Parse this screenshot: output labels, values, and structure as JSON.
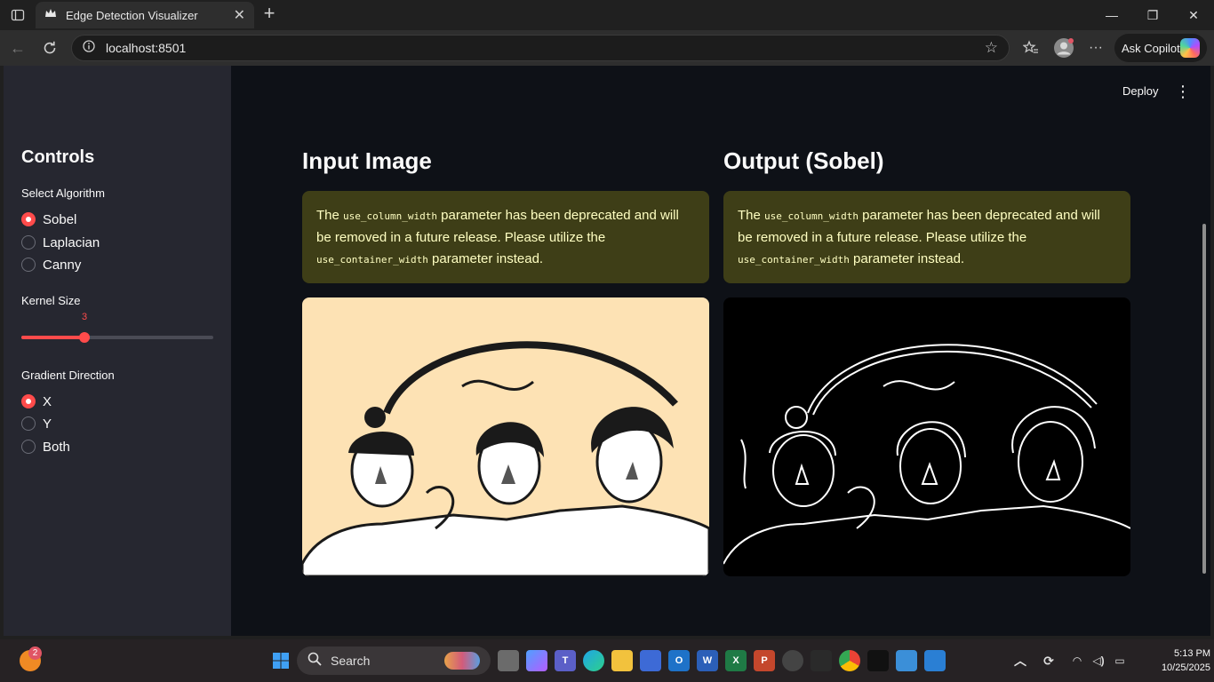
{
  "browser": {
    "tab_title": "Edge Detection Visualizer",
    "url": "localhost:8501",
    "copilot_label": "Ask Copilot"
  },
  "app": {
    "deploy_label": "Deploy",
    "sidebar": {
      "title": "Controls",
      "algorithm_label": "Select Algorithm",
      "algorithms": [
        {
          "label": "Sobel",
          "selected": true
        },
        {
          "label": "Laplacian",
          "selected": false
        },
        {
          "label": "Canny",
          "selected": false
        }
      ],
      "kernel_label": "Kernel Size",
      "kernel_value": "3",
      "kernel_fraction": 0.33,
      "direction_label": "Gradient Direction",
      "directions": [
        {
          "label": "X",
          "selected": true
        },
        {
          "label": "Y",
          "selected": false
        },
        {
          "label": "Both",
          "selected": false
        }
      ]
    },
    "input_title": "Input Image",
    "output_title": "Output (Sobel)",
    "warning": {
      "pre": "The ",
      "code1": "use_column_width",
      "mid": " parameter has been deprecated and will be removed in a future release. Please utilize the ",
      "code2": "use_container_width",
      "post": " parameter instead."
    }
  },
  "taskbar": {
    "search_label": "Search",
    "notification_count": "2",
    "time": "5:13 PM",
    "date": "10/25/2025"
  },
  "colors": {
    "accent": "#ff4b4b",
    "warning_bg": "#3e3e17",
    "app_bg": "#0e1117",
    "sidebar_bg": "#262730"
  }
}
